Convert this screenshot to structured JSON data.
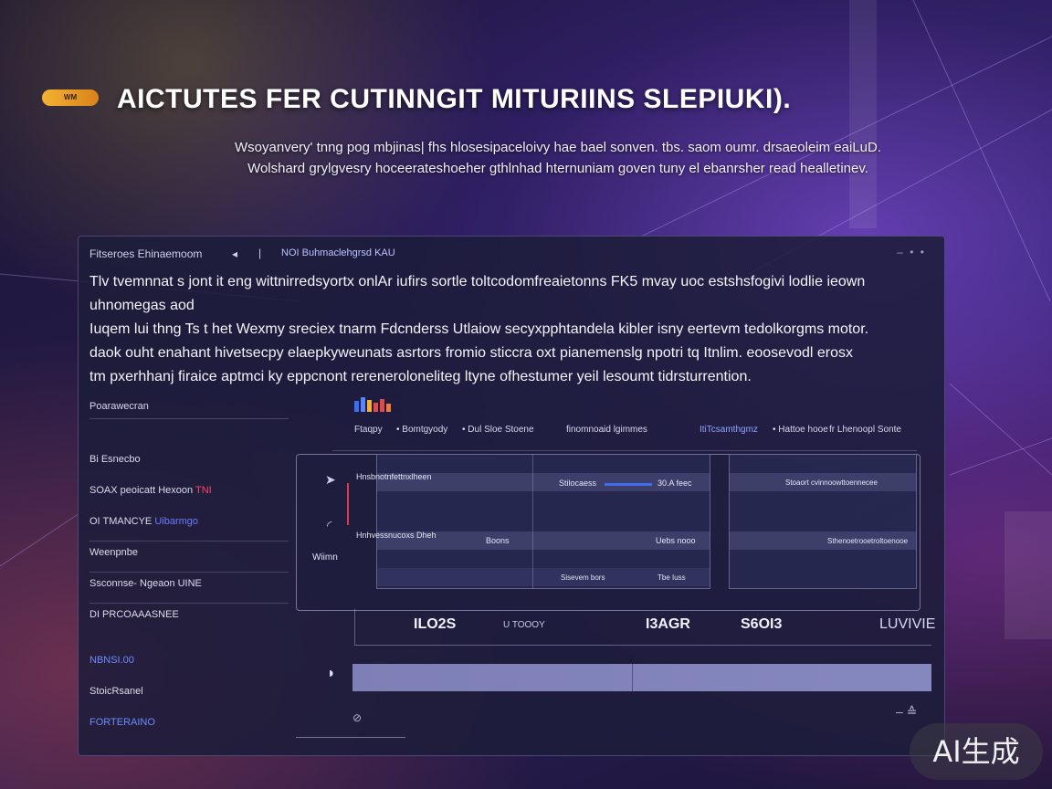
{
  "hero": {
    "logo_text": "WM",
    "title": "AICTUTES FER CUTINNGIT  MITURIINS  SLEPIUKI).",
    "subtitle_lines": [
      "Wsoyanvery' tnng pog mbjinas| fhs hlosesipaceloivy hae bael sonven. tbs. saom oumr. drsaeoleim eaiLuD.",
      "Wolshard grylgvesry hoceerateshoeher gthlnhad hternuniam goven tuny el ebanrsher read healletinev."
    ]
  },
  "panel": {
    "crumb": "Fitseroes Ehinaemoom",
    "crumb_arrow": "◂",
    "crumb_sep": "|",
    "crumb2": "NOI Buhmaclehgrsd KAU",
    "dots": "– • •",
    "desc_lines": [
      "Tlv tvemnnat s jont it eng wittnirredsyortx onlAr iufirs sortle toltcodomfreaietonns FK5 mvay uoc estshsfogivi lodlie ieown",
      "uhnomegas aod",
      "Iuqem lui thng Ts t het Wexmy sreciex tnarm Fdcnderss Utlaiow secyxpphtandela kibler isny eertevm tedolkorgms motor.",
      "daok ouht enahant hivetsecpy elaepkyweunats asrtors fromio sticcra oxt pianemenslg npotri tq Itnlim. eoosevodl erosx",
      "tm pxerhhanj firaice aptmci ky eppcnont rereneroloneliteg ltyne ofhestumer yeil lesoumt tidrsturrention."
    ]
  },
  "sidebar": {
    "items": [
      {
        "label": "Poarawecran"
      },
      {
        "label": "Bi Esnecbo"
      },
      {
        "label": "SOAX peoicatt Hexoon",
        "accent": "TNI"
      },
      {
        "label": "OI TMANCYE",
        "accent": "Uibarmgo"
      },
      {
        "label": "Weenpnbe"
      },
      {
        "label": "Ssconnse- Ngeaon UINE"
      },
      {
        "label": "DI PRCOAAASNEE"
      },
      {
        "label": "NBNSI.00"
      },
      {
        "label": "StoicRsanel"
      },
      {
        "label": "FORTERAINO"
      }
    ]
  },
  "tabs": [
    {
      "label": "Ftaqpy"
    },
    {
      "label": "• Bomtgyody"
    },
    {
      "label": "• Dul Sloe Stoene"
    },
    {
      "label": "finomnoaid lgimmes"
    },
    {
      "label": "ItiTcsamthgmz",
      "active": true
    },
    {
      "label": "• Hattoe hooe"
    },
    {
      "label": "fr Lhenoopl Sonte"
    }
  ],
  "inner": {
    "left_icon_1": "➤",
    "left_icon_2": "◜",
    "left_label_2": "Wiimn",
    "rows": [
      {
        "label": "Hnsbnotnfettnxlheen"
      },
      {
        "label": "Hnhvessnucoxs Dheh"
      }
    ],
    "cells": {
      "a1": "Stilocaess",
      "a1_value": "30.A feec",
      "a2": "Boons",
      "a2_value": "Uebs nooo",
      "a3": "Sisevem bors",
      "a3_value": "Tbe Iuss",
      "b1": "Stoaort cvinnoowttoennecee",
      "b2": "Sthenoetrooetroltoenooe"
    }
  },
  "stats": {
    "s1": "ILO2S",
    "s2": "U TOOOY",
    "s3": "I3AGR",
    "s4": "S6OI3",
    "s5": "LUVIVIE"
  },
  "footer": {
    "play_icon": "◗",
    "left_icon": "⊘",
    "right_icon": "– ≙"
  },
  "watermark": "AI生成",
  "colors": {
    "accent_red": "#ff4466",
    "accent_blue": "#6a7cff",
    "logo_gold": "#f3b233",
    "panel_bg": "#1c1c3a"
  }
}
